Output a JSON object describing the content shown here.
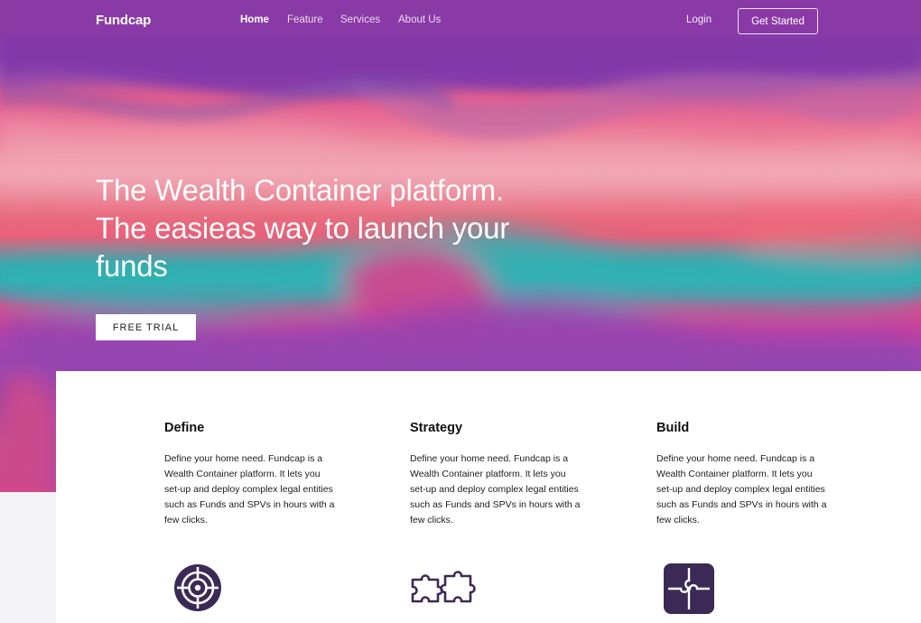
{
  "brand": "Fundcap",
  "nav": {
    "links": [
      "Home",
      "Feature",
      "Services",
      "About Us"
    ],
    "active_index": 0,
    "login": "Login",
    "cta": "Get Started"
  },
  "hero": {
    "headline": "The Wealth Container platform. The easieas way to launch your funds",
    "cta": "FREE TRIAL"
  },
  "features": [
    {
      "title": "Define",
      "text": "Define your home need. Fundcap is a Wealth Container platform. It lets you set-up and deploy complex legal entities such as Funds and SPVs in hours with a few clicks.",
      "icon": "target-icon"
    },
    {
      "title": "Strategy",
      "text": "Define your home need. Fundcap is a Wealth Container platform. It lets you set-up and deploy complex legal entities such as Funds and SPVs in hours with a few clicks.",
      "icon": "puzzle-pieces-icon"
    },
    {
      "title": "Build",
      "text": "Define your home need. Fundcap is a Wealth Container platform. It lets you set-up and deploy complex legal entities such as Funds and SPVs in hours with a few clicks.",
      "icon": "puzzle-block-icon"
    }
  ],
  "colors": {
    "nav_purple": "#8a3aa6",
    "icon_dark": "#3a2a55",
    "teal": "#2eb0b2",
    "pink": "#e8607a"
  }
}
